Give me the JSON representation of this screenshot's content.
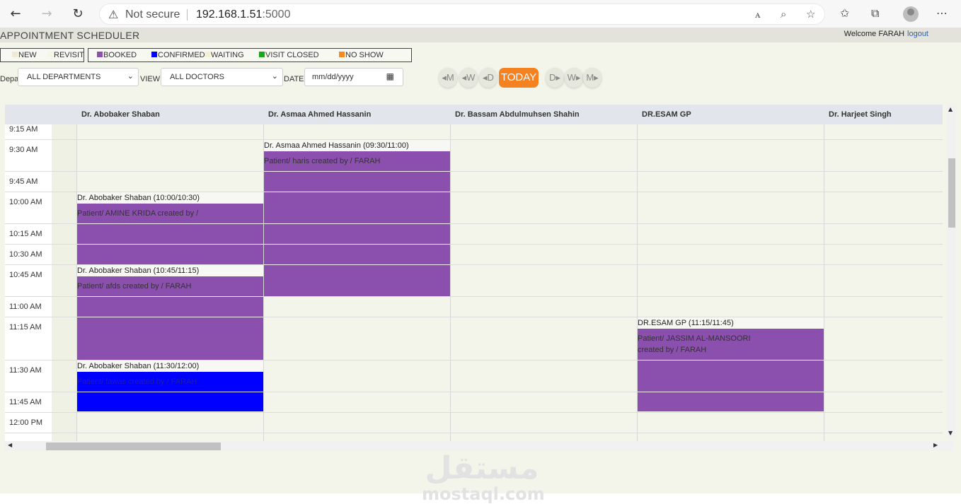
{
  "browser": {
    "not_secure": "Not secure",
    "url_host": "192.168.1.51",
    "url_port": ":5000"
  },
  "app": {
    "title": "APPOINTMENT SCHEDULER",
    "welcome": "Welcome FARAH",
    "logout": "logout"
  },
  "legend": {
    "new": "NEW",
    "revisit": "REVISIT",
    "booked": "BOOKED",
    "confirmed": "CONFIRMED",
    "waiting": "WAITING",
    "visit_closed": "VISIT CLOSED",
    "no_show": "NO SHOW",
    "colors": {
      "new": "#f0ead2",
      "revisit": "#f6f6e6",
      "booked": "#8b4fad",
      "confirmed": "#0000ff",
      "waiting": "#f4f0d2",
      "visit_closed": "#17a817",
      "no_show": "#f58a1f"
    }
  },
  "filters": {
    "department_label": "Depar",
    "department_value": "ALL DEPARTMENTS",
    "view_label": "VIEW",
    "doctor_value": "ALL DOCTORS",
    "date_label": "DATE",
    "date_placeholder": "mm/dd/yyyy"
  },
  "nav": {
    "prev_month": "◂M",
    "prev_week": "◂W",
    "prev_day": "◂D",
    "today": "TODAY",
    "next_day": "D▸",
    "next_week": "W▸",
    "next_month": "M▸"
  },
  "doctors": [
    "Dr. Abobaker Shaban",
    "Dr. Asmaa Ahmed Hassanin",
    "Dr. Bassam Abdulmuhsen Shahin",
    "DR.ESAM GP",
    "Dr. Harjeet Singh"
  ],
  "times": [
    "9:15 AM",
    "9:30 AM",
    "9:45 AM",
    "10:00 AM",
    "10:15 AM",
    "10:30 AM",
    "10:45 AM",
    "11:00 AM",
    "11:15 AM",
    "11:30 AM",
    "11:45 AM",
    "12:00 PM"
  ],
  "appointments": [
    {
      "title": "Dr. Asmaa Ahmed Hassanin (09:30/11:00)",
      "line1": "Patient/ haris created by / FARAH",
      "line2": ""
    },
    {
      "title": "Dr. Abobaker Shaban (10:00/10:30)",
      "line1": "Patient/ AMINE KRIDA created by /",
      "line2": ""
    },
    {
      "title": "Dr. Abobaker Shaban (10:45/11:15)",
      "line1": "Patient/ afds created by / FARAH",
      "line2": ""
    },
    {
      "title": "Dr. Abobaker Shaban (11:30/12:00)",
      "line1": "Patient/ fawas created by / FARAH",
      "line2": ""
    },
    {
      "title": "DR.ESAM GP (11:15/11:45)",
      "line1": "Patient/ JASSIM AL-MANSOORI",
      "line2": "created by / FARAH"
    }
  ],
  "watermark": {
    "arabic": "مستقل",
    "latin": "mostaql.com"
  }
}
